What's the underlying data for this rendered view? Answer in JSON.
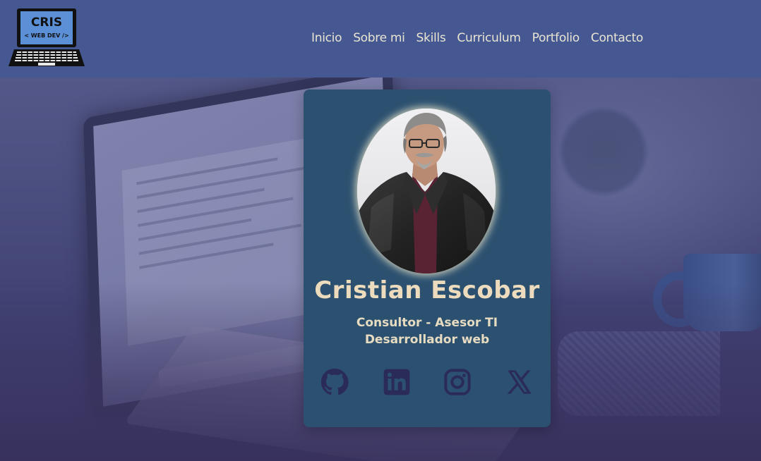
{
  "header": {
    "logo": {
      "line1": "CRIS",
      "line2": "< WEB DEV />"
    },
    "nav": [
      {
        "label": "Inicio"
      },
      {
        "label": "Sobre mi"
      },
      {
        "label": "Skills"
      },
      {
        "label": "Curriculum"
      },
      {
        "label": "Portfolio"
      },
      {
        "label": "Contacto"
      }
    ]
  },
  "profile": {
    "name": "Cristian Escobar",
    "role_line1": "Consultor - Asesor TI",
    "role_line2": "Desarrollador web",
    "photo_icon": "profile-photo",
    "socials": [
      {
        "icon": "github-icon"
      },
      {
        "icon": "linkedin-icon"
      },
      {
        "icon": "instagram-icon"
      },
      {
        "icon": "x-icon"
      }
    ]
  },
  "colors": {
    "header_bg": "#455892",
    "nav_text": "#eae5d3",
    "card_bg": "#2c5170",
    "card_text": "#ecdcbd",
    "social_icon": "#2b2b5a"
  }
}
